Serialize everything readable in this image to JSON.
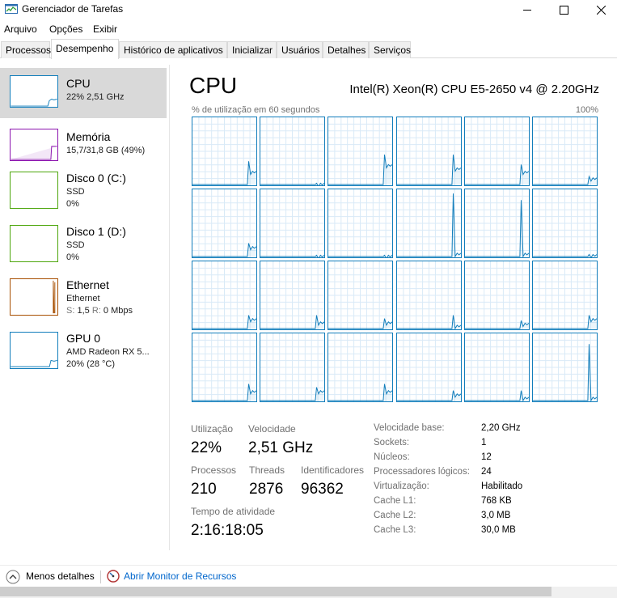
{
  "window": {
    "title": "Gerenciador de Tarefas"
  },
  "menu": [
    "Arquivo",
    "Opções",
    "Exibir"
  ],
  "tabs": [
    "Processos",
    "Desempenho",
    "Histórico de aplicativos",
    "Inicializar",
    "Usuários",
    "Detalhes",
    "Serviços"
  ],
  "active_tab": "Desempenho",
  "sidebar": {
    "cpu": {
      "name": "CPU",
      "line1": "22% 2,51 GHz",
      "color": "#117dbb",
      "level": 0.22
    },
    "memory": {
      "name": "Memória",
      "line1": "15,7/31,8 GB (49%)",
      "color": "#8b12ae",
      "level": 0.49
    },
    "disk0": {
      "name": "Disco 0 (C:)",
      "line1": "SSD",
      "line2": "0%",
      "color": "#4da60c"
    },
    "disk1": {
      "name": "Disco 1 (D:)",
      "line1": "SSD",
      "line2": "0%",
      "color": "#4da60c"
    },
    "ethernet": {
      "name": "Ethernet",
      "line1": "Ethernet",
      "send_label": "S:",
      "send": "1,5",
      "recv_label": "R:",
      "recv": "0 Mbps",
      "color": "#a74f01"
    },
    "gpu": {
      "name": "GPU 0",
      "line1": "AMD Radeon RX 5...",
      "line2": "20% (28 °C)",
      "color": "#117dbb",
      "level": 0.2
    }
  },
  "main": {
    "title": "CPU",
    "model": "Intel(R) Xeon(R) CPU E5-2650 v4 @ 2.20GHz",
    "graph_label": "% de utilização em 60 segundos",
    "graph_max": "100%",
    "graph_color": "#117dbb",
    "cores": [
      {
        "peak": 0.35,
        "tail": 0.2
      },
      {
        "peak": 0.02,
        "tail": 0.02
      },
      {
        "peak": 0.45,
        "tail": 0.3
      },
      {
        "peak": 0.45,
        "tail": 0.25
      },
      {
        "peak": 0.3,
        "tail": 0.2
      },
      {
        "peak": 0.12,
        "tail": 0.1
      },
      {
        "peak": 0.2,
        "tail": 0.15
      },
      {
        "peak": 0.02,
        "tail": 0.02
      },
      {
        "peak": 0.02,
        "tail": 0.02
      },
      {
        "peak": 0.95,
        "tail": 0.05
      },
      {
        "peak": 0.85,
        "tail": 0.05
      },
      {
        "peak": 0.03,
        "tail": 0.03
      },
      {
        "peak": 0.2,
        "tail": 0.15
      },
      {
        "peak": 0.2,
        "tail": 0.1
      },
      {
        "peak": 0.15,
        "tail": 0.1
      },
      {
        "peak": 0.2,
        "tail": 0.05
      },
      {
        "peak": 0.12,
        "tail": 0.08
      },
      {
        "peak": 0.2,
        "tail": 0.15
      },
      {
        "peak": 0.25,
        "tail": 0.15
      },
      {
        "peak": 0.2,
        "tail": 0.15
      },
      {
        "peak": 0.25,
        "tail": 0.15
      },
      {
        "peak": 0.15,
        "tail": 0.1
      },
      {
        "peak": 0.15,
        "tail": 0.05
      },
      {
        "peak": 0.85,
        "tail": 0.05
      }
    ],
    "stats": {
      "utilization_label": "Utilização",
      "utilization": "22%",
      "speed_label": "Velocidade",
      "speed": "2,51 GHz",
      "processes_label": "Processos",
      "processes": "210",
      "threads_label": "Threads",
      "threads": "2876",
      "handles_label": "Identificadores",
      "handles": "96362",
      "uptime_label": "Tempo de atividade",
      "uptime": "2:16:18:05"
    },
    "details": [
      {
        "key": "Velocidade base:",
        "value": "2,20 GHz"
      },
      {
        "key": "Sockets:",
        "value": "1"
      },
      {
        "key": "Núcleos:",
        "value": "12"
      },
      {
        "key": "Processadores lógicos:",
        "value": "24"
      },
      {
        "key": "Virtualização:",
        "value": "Habilitado"
      },
      {
        "key": "Cache L1:",
        "value": "768 KB"
      },
      {
        "key": "Cache L2:",
        "value": "3,0 MB"
      },
      {
        "key": "Cache L3:",
        "value": "30,0 MB"
      }
    ]
  },
  "footer": {
    "less_details": "Menos detalhes",
    "resource_monitor": "Abrir Monitor de Recursos"
  }
}
